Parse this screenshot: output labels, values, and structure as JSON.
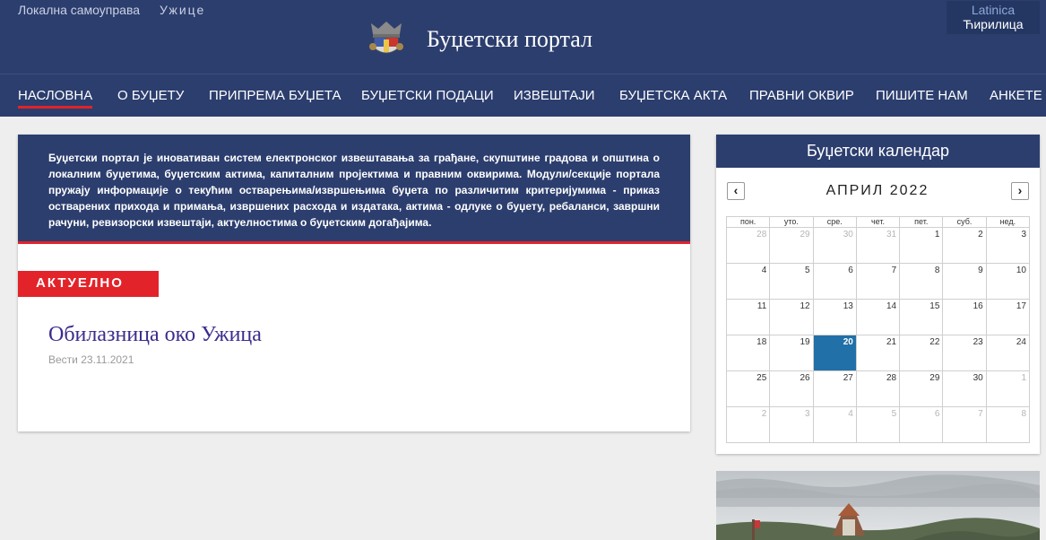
{
  "top_links": [
    "Локална самоуправа",
    "Ужице"
  ],
  "site_title": "Буџетски портал",
  "language": {
    "latin": "Latinica",
    "cyrillic": "Ћирилица"
  },
  "nav": [
    {
      "label": "НАСЛОВНА",
      "active": true
    },
    {
      "label": "О БУЏЕТУ"
    },
    {
      "label": "ПРИПРЕМА БУЏЕТА"
    },
    {
      "label": "БУЏЕТСКИ ПОДАЦИ"
    },
    {
      "label": "ИЗВЕШТАЈИ"
    },
    {
      "label": "БУЏЕТСКА АКТА"
    },
    {
      "label": "ПРАВНИ ОКВИР"
    },
    {
      "label": "ПИШИТЕ НАМ"
    },
    {
      "label": "АНКЕТЕ"
    }
  ],
  "intro_text": "Буџетски портал је иновативан систем електронског извештавања за грађане, скупштине градова и општина о локалним буџетима, буџетским актима, капиталним пројектима и правним оквирима. Модули/секције портала пружају информације о текућим остварењима/извршењима буџета по различитим критеријумима - приказ остварених прихода и примања, извршених расхода и издатака, актима - одлуке о буџету, ребаланси, завршни рачуни, ревизорски извештаји, актуелностима о буџетским догађајима.",
  "news": {
    "section_label": "АКТУЕЛНО",
    "title": "Обилазница око Ужица",
    "category": "Вести",
    "date": "23.11.2021"
  },
  "calendar": {
    "heading": "Буџетски календар",
    "month_label": "АПРИЛ 2022",
    "prev": "‹",
    "next": "›",
    "weekdays": [
      "пон.",
      "уто.",
      "сре.",
      "чет.",
      "пет.",
      "суб.",
      "нед."
    ],
    "weeks": [
      [
        "28",
        "29",
        "30",
        "31",
        "1",
        "2",
        "3"
      ],
      [
        "4",
        "5",
        "6",
        "7",
        "8",
        "9",
        "10"
      ],
      [
        "11",
        "12",
        "13",
        "14",
        "15",
        "16",
        "17"
      ],
      [
        "18",
        "19",
        "20",
        "21",
        "22",
        "23",
        "24"
      ],
      [
        "25",
        "26",
        "27",
        "28",
        "29",
        "30",
        "1"
      ],
      [
        "2",
        "3",
        "4",
        "5",
        "6",
        "7",
        "8"
      ]
    ],
    "today": "20"
  },
  "colors": {
    "header_bg": "#2c3e6e",
    "accent_red": "#e2232a",
    "today_bg": "#2170a8",
    "news_title": "#3a2c8c"
  }
}
